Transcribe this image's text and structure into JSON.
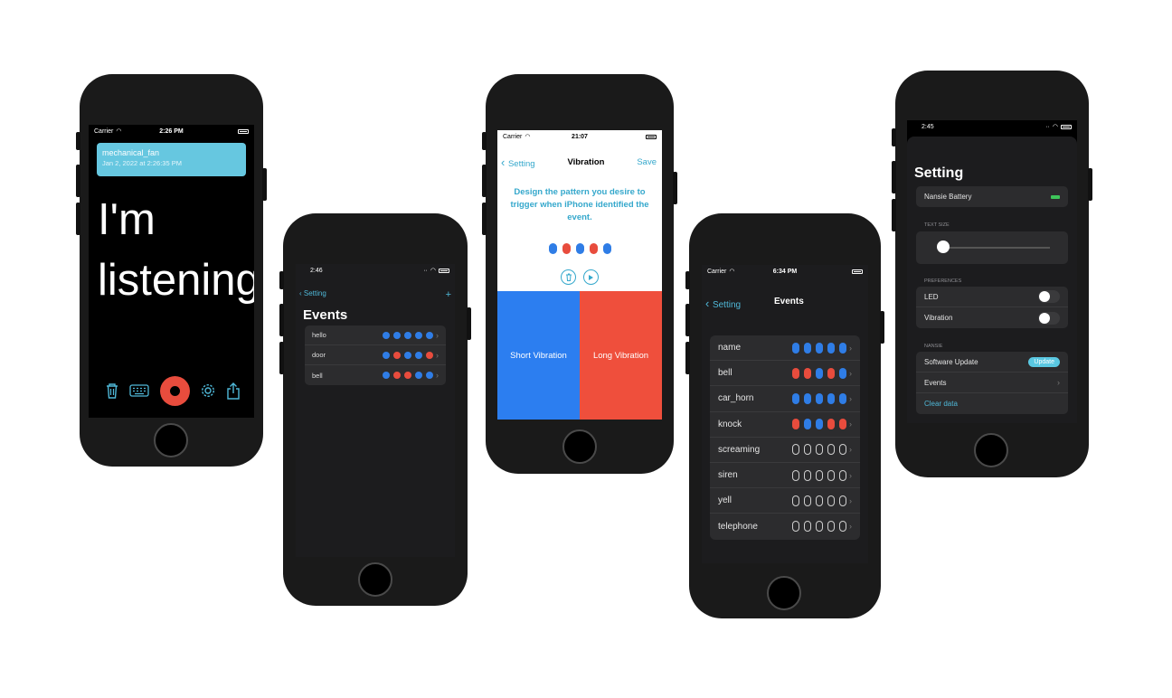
{
  "colors": {
    "accent": "#4fb8d8",
    "blue_pulse": "#2f7de6",
    "red_pulse": "#e84c3d",
    "short_vibration": "#2c7ef0",
    "long_vibration": "#ef4f3c"
  },
  "phone1": {
    "status": {
      "carrier": "Carrier",
      "time": "2:26 PM"
    },
    "card": {
      "title": "mechanical_fan",
      "date": "Jan 2, 2022 at 2:26:35 PM"
    },
    "big_text": "I'm listening",
    "icons": [
      "trash-icon",
      "keyboard-icon",
      "record-icon",
      "gear-icon",
      "share-icon"
    ]
  },
  "phone2": {
    "status": {
      "time": "2:46"
    },
    "nav": {
      "back": "Setting",
      "add": "+"
    },
    "title": "Events",
    "events": [
      {
        "name": "hello",
        "pattern": [
          "b",
          "b",
          "b",
          "b",
          "b"
        ]
      },
      {
        "name": "door",
        "pattern": [
          "b",
          "r",
          "b",
          "b",
          "r"
        ]
      },
      {
        "name": "bell",
        "pattern": [
          "b",
          "r",
          "r",
          "b",
          "b"
        ]
      }
    ]
  },
  "phone3": {
    "status": {
      "carrier": "Carrier",
      "time": "21:07"
    },
    "nav": {
      "back": "Setting",
      "title": "Vibration",
      "save": "Save"
    },
    "description": "Design the pattern you desire to trigger when iPhone identified the event.",
    "pattern": [
      "b",
      "r",
      "b",
      "r",
      "b"
    ],
    "short_label": "Short Vibration",
    "long_label": "Long Vibration"
  },
  "phone4": {
    "status": {
      "carrier": "Carrier",
      "time": "6:34 PM"
    },
    "nav": {
      "back": "Setting",
      "title": "Events"
    },
    "events": [
      {
        "name": "name",
        "pattern": [
          "b",
          "b",
          "b",
          "b",
          "b"
        ]
      },
      {
        "name": "bell",
        "pattern": [
          "r",
          "r",
          "b",
          "r",
          "b"
        ]
      },
      {
        "name": "car_horn",
        "pattern": [
          "b",
          "b",
          "b",
          "b",
          "b"
        ]
      },
      {
        "name": "knock",
        "pattern": [
          "r",
          "b",
          "b",
          "r",
          "r"
        ]
      },
      {
        "name": "screaming",
        "pattern": [
          "o",
          "o",
          "o",
          "o",
          "o"
        ]
      },
      {
        "name": "siren",
        "pattern": [
          "o",
          "o",
          "o",
          "o",
          "o"
        ]
      },
      {
        "name": "yell",
        "pattern": [
          "o",
          "o",
          "o",
          "o",
          "o"
        ]
      },
      {
        "name": "telephone",
        "pattern": [
          "o",
          "o",
          "o",
          "o",
          "o"
        ]
      }
    ]
  },
  "phone5": {
    "status": {
      "time": "2:45"
    },
    "title": "Setting",
    "battery_label": "Nansie Battery",
    "text_size_header": "TEXT SIZE",
    "text_size_value": 0.05,
    "preferences_header": "PREFERENCES",
    "led_label": "LED",
    "vibration_label": "Vibration",
    "nansie_header": "NANSIE",
    "software_update_label": "Software Update",
    "update_button": "Update",
    "events_label": "Events",
    "clear_data_label": "Clear data"
  }
}
